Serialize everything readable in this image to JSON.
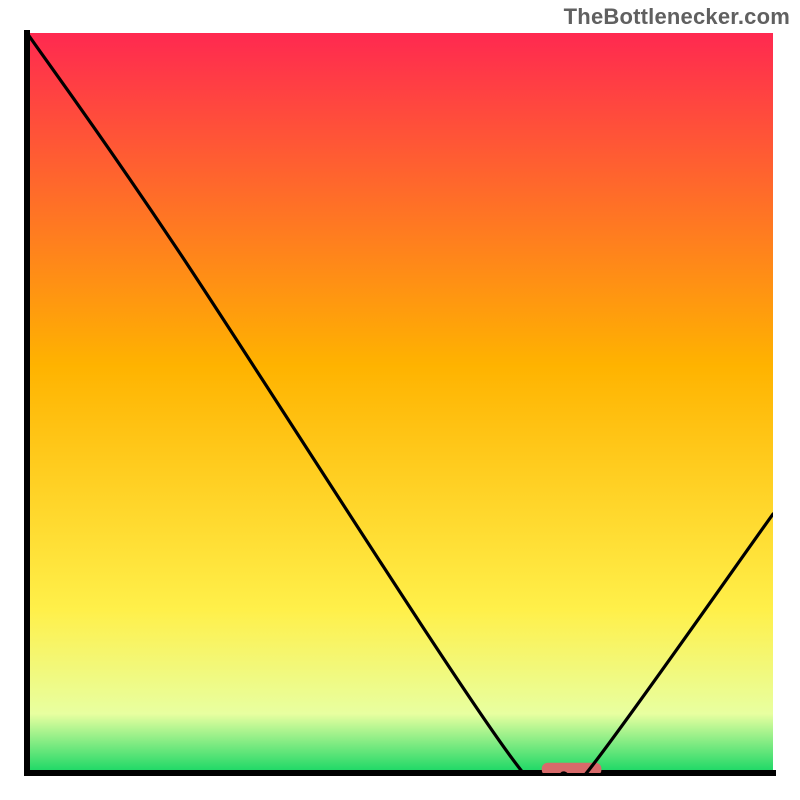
{
  "attribution": "TheBottlenecker.com",
  "chart_data": {
    "type": "line",
    "title": "",
    "xlabel": "",
    "ylabel": "",
    "xlim": [
      0,
      100
    ],
    "ylim": [
      0,
      100
    ],
    "curve": [
      {
        "x": 0,
        "y": 100
      },
      {
        "x": 20,
        "y": 71
      },
      {
        "x": 65,
        "y": 2
      },
      {
        "x": 72,
        "y": 0
      },
      {
        "x": 75,
        "y": 0
      },
      {
        "x": 100,
        "y": 35
      }
    ],
    "marker": {
      "x_start": 69,
      "x_end": 77,
      "y": 0.5
    },
    "background_gradient": {
      "top": "#ff2950",
      "mid_upper": "#ffb300",
      "mid_lower": "#fff04a",
      "near_bottom": "#e8ffa0",
      "bottom": "#17d765"
    },
    "axis_color": "#000000",
    "line_color": "#000000",
    "marker_color": "#d86a6a"
  }
}
